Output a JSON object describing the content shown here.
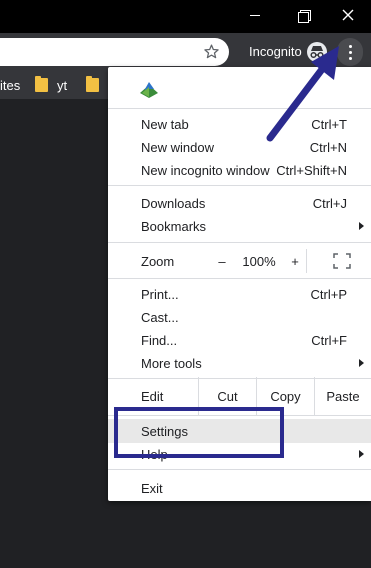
{
  "window": {
    "controls": [
      "minimize",
      "maximize",
      "close"
    ]
  },
  "toolbar": {
    "incognito_label": "Incognito",
    "icons": [
      "star-icon",
      "incognito-icon",
      "kebab-menu-icon"
    ]
  },
  "bookmarks": {
    "items": [
      {
        "label": "ites"
      },
      {
        "label": "yt"
      },
      {
        "label": ""
      }
    ]
  },
  "menu": {
    "items": {
      "new_tab": {
        "label": "New tab",
        "shortcut": "Ctrl+T"
      },
      "new_window": {
        "label": "New window",
        "shortcut": "Ctrl+N"
      },
      "new_incognito": {
        "label": "New incognito window",
        "shortcut": "Ctrl+Shift+N"
      },
      "downloads": {
        "label": "Downloads",
        "shortcut": "Ctrl+J"
      },
      "bookmarks": {
        "label": "Bookmarks"
      },
      "print": {
        "label": "Print...",
        "shortcut": "Ctrl+P"
      },
      "cast": {
        "label": "Cast..."
      },
      "find": {
        "label": "Find...",
        "shortcut": "Ctrl+F"
      },
      "more_tools": {
        "label": "More tools"
      },
      "settings": {
        "label": "Settings"
      },
      "help": {
        "label": "Help"
      },
      "exit": {
        "label": "Exit"
      }
    },
    "zoom": {
      "label": "Zoom",
      "minus": "–",
      "level": "100%",
      "plus": "+"
    },
    "edit": {
      "label": "Edit",
      "cut": "Cut",
      "copy": "Copy",
      "paste": "Paste"
    }
  },
  "annotation": {
    "color": "#2a2a8e"
  }
}
